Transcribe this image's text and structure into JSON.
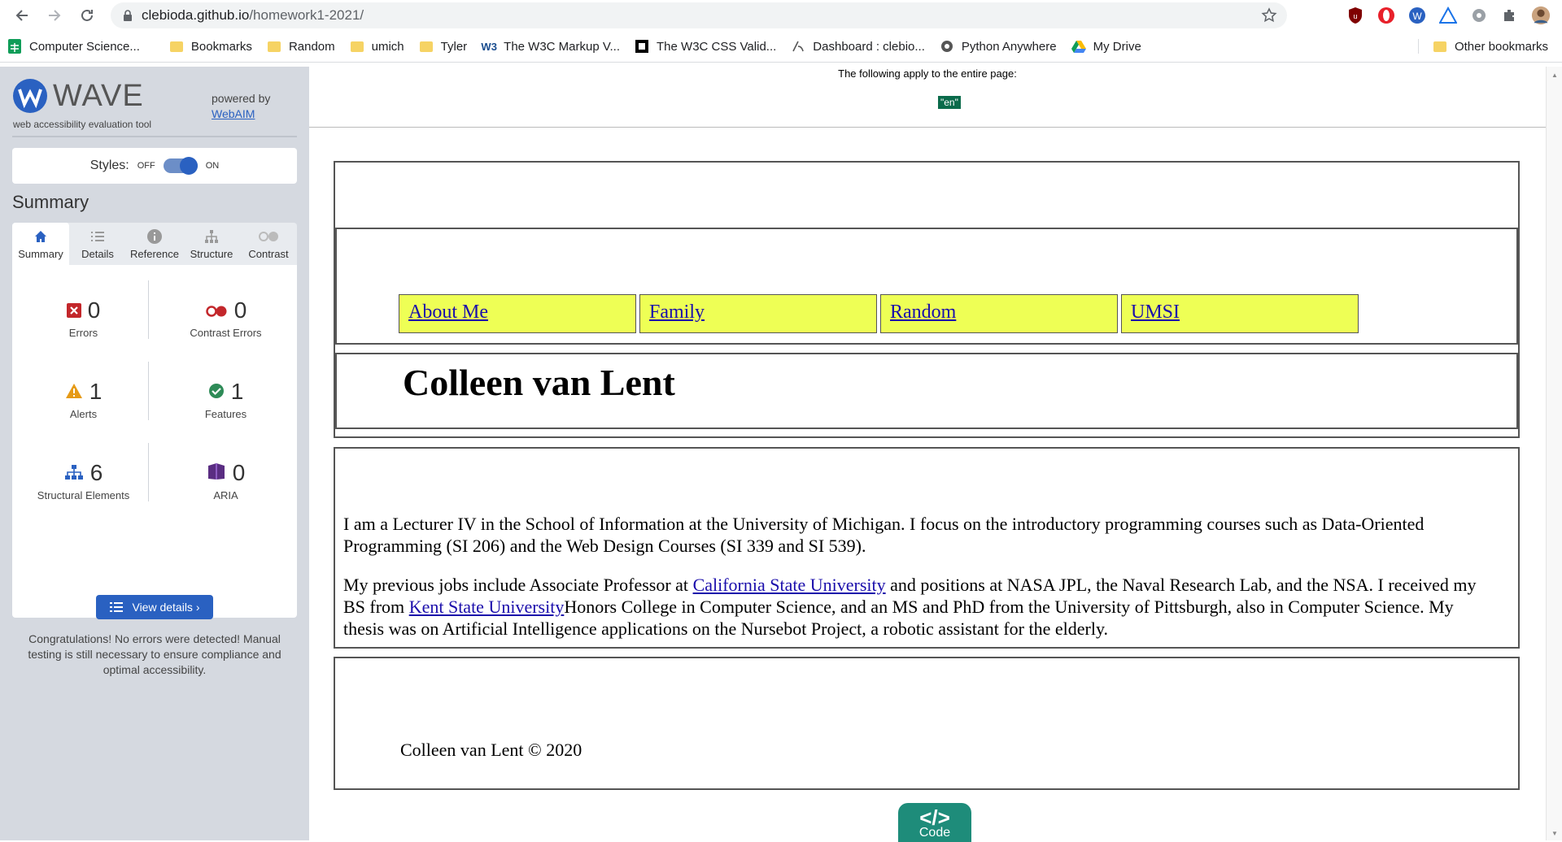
{
  "browser": {
    "url_host": "clebioda.github.io",
    "url_path": "/homework1-2021/",
    "bookmarks": [
      {
        "label": "Computer Science...",
        "icon": "sheets-icon"
      },
      {
        "label": "Bookmarks",
        "icon": "folder-icon"
      },
      {
        "label": "Random",
        "icon": "folder-icon"
      },
      {
        "label": "umich",
        "icon": "folder-icon"
      },
      {
        "label": "Tyler",
        "icon": "folder-icon"
      },
      {
        "label": "The W3C Markup V...",
        "icon": "w3c-icon"
      },
      {
        "label": "The W3C CSS Valid...",
        "icon": "w3c-css-icon"
      },
      {
        "label": "Dashboard : clebio...",
        "icon": "canvas-icon"
      },
      {
        "label": "Python Anywhere",
        "icon": "python-anywhere-icon"
      },
      {
        "label": "My Drive",
        "icon": "google-drive-icon"
      }
    ],
    "other_bookmarks": "Other bookmarks"
  },
  "wave": {
    "title": "WAVE",
    "tagline": "web accessibility evaluation tool",
    "powered_by": "powered by",
    "webaim": "WebAIM",
    "styles_label": "Styles:",
    "styles_off": "OFF",
    "styles_on": "ON",
    "summary_heading": "Summary",
    "tabs": [
      "Summary",
      "Details",
      "Reference",
      "Structure",
      "Contrast"
    ],
    "stats": [
      {
        "value": "0",
        "label": "Errors",
        "icon": "error-icon",
        "color": "#c3272b"
      },
      {
        "value": "0",
        "label": "Contrast Errors",
        "icon": "contrast-error-icon",
        "color": "#c3272b"
      },
      {
        "value": "1",
        "label": "Alerts",
        "icon": "alert-icon",
        "color": "#e69a16"
      },
      {
        "value": "1",
        "label": "Features",
        "icon": "feature-icon",
        "color": "#2e8b57"
      },
      {
        "value": "6",
        "label": "Structural Elements",
        "icon": "structure-icon",
        "color": "#2a61c1"
      },
      {
        "value": "0",
        "label": "ARIA",
        "icon": "aria-icon",
        "color": "#5a2d82"
      }
    ],
    "view_details": "View details ›",
    "congrats": "Congratulations! No errors were detected! Manual testing is still necessary to ensure compliance and optimal accessibility."
  },
  "page": {
    "applies_text": "The following apply to the entire page:",
    "lang_badge": "\"en\"",
    "nav": [
      "About Me",
      "Family",
      "Random",
      "UMSI"
    ],
    "name": "Colleen van Lent",
    "bio1": "I am a Lecturer IV in the School of Information at the University of Michigan. I focus on the introductory programming courses such as Data-Oriented Programming (SI 206) and the Web Design Courses (SI 339 and SI 539).",
    "bio2_a": "My previous jobs include Associate Professor at ",
    "bio2_link1": "California State University",
    "bio2_b": " and positions at NASA JPL, the Naval Research Lab, and the NSA. I received my BS from ",
    "bio2_link2": "Kent State University",
    "bio2_c": "Honors College in Computer Science, and an MS and PhD from the University of Pittsburgh, also in Computer Science. My thesis was on Artificial Intelligence applications on the Nursebot Project, a robotic assistant for the elderly.",
    "footer": "Colleen van Lent © 2020",
    "code_symbol": "</>",
    "code_label": "Code"
  }
}
